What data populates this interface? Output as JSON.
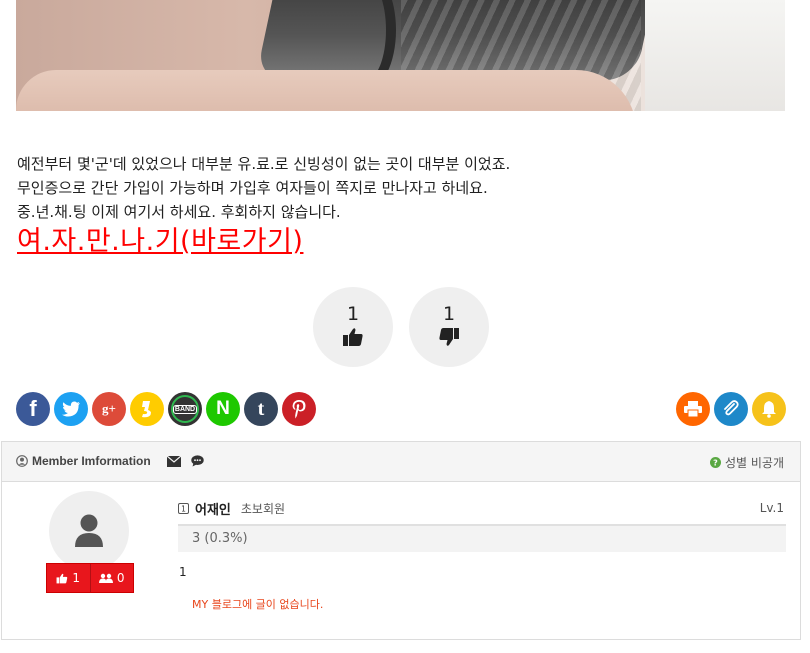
{
  "article": {
    "lines": [
      "예전부터 몇'군'데 있었으나 대부분 유.료.로 신빙성이 없는 곳이 대부분 이었죠.",
      "무인증으로 간단 가입이 가능하며 가입후 여자들이 쪽지로 만나자고 하네요.",
      "중.년.채.팅 이제 여기서 하세요. 후회하지 않습니다."
    ],
    "link_text": "여.자.만.나.기(바로가기)"
  },
  "votes": {
    "up": "1",
    "down": "1"
  },
  "share": {
    "icons": [
      "facebook-icon",
      "twitter-icon",
      "google-plus-icon",
      "kakaostory-icon",
      "band-icon",
      "naver-icon",
      "tumblr-icon",
      "pinterest-icon"
    ],
    "tools": [
      "print-icon",
      "scrap-icon",
      "notify-icon"
    ],
    "band_label": "BAND",
    "naver_label": "N",
    "tumblr_label": "t",
    "google_label": "g+"
  },
  "member": {
    "header_title": "Member Imformation",
    "gender_label": "성별 비공개",
    "name": "어재인",
    "grade": "초보회원",
    "level": "Lv.1",
    "level_bar": "3 (0.3%)",
    "points": "1",
    "recommend_count": "1",
    "follower_count": "0",
    "blog_message": "MY 블로그에 글이 없습니다."
  },
  "colors": {
    "link_red": "#ff0000",
    "facebook": "#3b5998",
    "twitter": "#1da1f2",
    "google": "#dd4b39",
    "kakaostory": "#ffcc00",
    "band": "#333333",
    "naver": "#1ec800",
    "tumblr": "#35465c",
    "pinterest": "#cb2027",
    "print": "#ff6600",
    "scrap": "#1e88c9",
    "notify": "#f6c21a"
  }
}
